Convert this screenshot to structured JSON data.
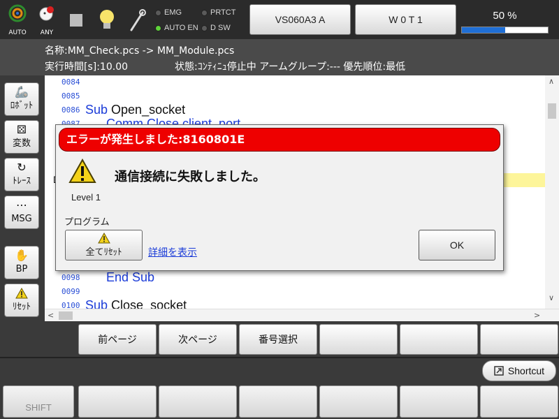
{
  "topbar": {
    "auto_label": "AUTO",
    "any_label": "ANY",
    "emg": "EMG",
    "prtct": "PRTCT",
    "auto_en": "AUTO EN",
    "dsw": "D SW",
    "robot_name": "VS060A3 A",
    "work": "W 0 T 1",
    "speed_label": "50 %",
    "speed_percent": 50,
    "colors": {
      "speed_fill": "#1f6fd6",
      "led_on": "#5fd43a"
    }
  },
  "info": {
    "name_line": "名称:MM_Check.pcs -> MM_Module.pcs",
    "exec_time": "実行時間[s]:10.00",
    "status": "状態:ｺﾝﾃｨﾆｭ停止中 アームグループ:--- 優先順位:最低"
  },
  "sidebar": [
    {
      "label": "ﾛﾎﾞｯﾄ",
      "icon": "robot-arm-icon"
    },
    {
      "label": "変数",
      "icon": "dice-icon"
    },
    {
      "label": "ﾄﾚｰｽ",
      "icon": "trace-icon"
    },
    {
      "label": "MSG",
      "icon": "message-bubble-icon"
    },
    {
      "label": "BP",
      "icon": "hand-stop-icon"
    },
    {
      "label": "ﾘｾｯﾄ",
      "icon": "warning-icon"
    }
  ],
  "code": {
    "lines": [
      {
        "num": "0084",
        "text": ""
      },
      {
        "num": "0085",
        "text": ""
      },
      {
        "num": "0086",
        "kw": "Sub",
        "text": " Open_socket"
      },
      {
        "num": "0087",
        "text": "      Comm.Close client_port"
      },
      {
        "num": "0098",
        "text": "      End Sub"
      },
      {
        "num": "0099",
        "text": ""
      },
      {
        "num": "0100",
        "kw": "Sub",
        "text": " Close_socket"
      }
    ],
    "hidden_marker": "D"
  },
  "dialog": {
    "title": "エラーが発生しました:8160801E",
    "message": "通信接続に失敗しました。",
    "level": "Level 1",
    "program_label": "プログラム",
    "reset_all": "全てﾘｾｯﾄ",
    "details": "詳細を表示",
    "ok": "OK",
    "title_color": "#ee0000"
  },
  "pages": {
    "prev": "前ページ",
    "next": "次ページ",
    "number_select": "番号選択",
    "empty1": "",
    "empty2": "",
    "empty3": ""
  },
  "shortcut": {
    "label": "Shortcut",
    "icon": "shortcut-arrow-icon"
  },
  "function_keys": [
    "SHIFT",
    "",
    "",
    "",
    "",
    "",
    ""
  ]
}
